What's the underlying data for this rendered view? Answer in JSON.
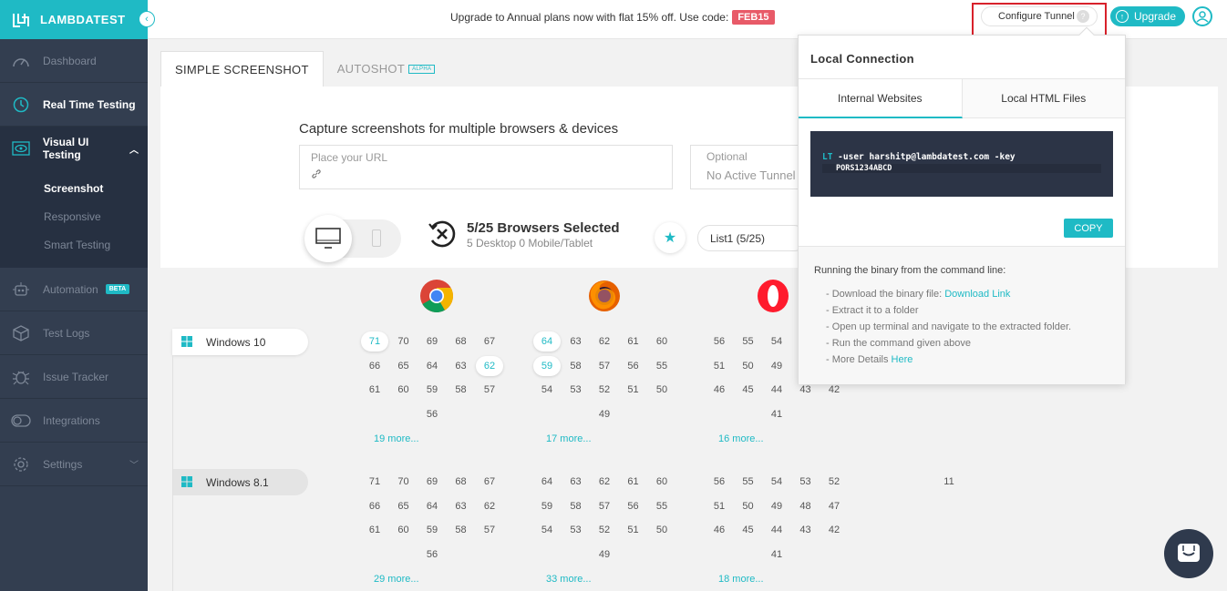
{
  "brand": {
    "name": "LAMBDATEST"
  },
  "sidebar": {
    "items": [
      {
        "label": "Dashboard"
      },
      {
        "label": "Real Time Testing"
      },
      {
        "label": "Visual UI Testing"
      },
      {
        "label": "Automation",
        "badge": "BETA"
      },
      {
        "label": "Test Logs"
      },
      {
        "label": "Issue Tracker"
      },
      {
        "label": "Integrations"
      },
      {
        "label": "Settings"
      }
    ],
    "sub_items": [
      {
        "label": "Screenshot"
      },
      {
        "label": "Responsive"
      },
      {
        "label": "Smart Testing"
      }
    ]
  },
  "topbar": {
    "promo_text": "Upgrade to Annual plans now with flat 15% off. Use code:",
    "promo_code": "FEB15",
    "tunnel_label": "Configure Tunnel",
    "tunnel_help": "?",
    "upgrade_label": "Upgrade"
  },
  "tabs": [
    {
      "label": "SIMPLE SCREENSHOT"
    },
    {
      "label": "AUTOSHOT",
      "badge": "ALPHA"
    }
  ],
  "main": {
    "capture_title": "Capture screenshots for multiple browsers & devices",
    "url_placeholder": "Place your URL",
    "tunnel_optional": "Optional",
    "tunnel_value": "No Active Tunnel",
    "browsers_selected": "5/25 Browsers Selected",
    "browsers_sub": "5 Desktop 0 Mobile/Tablet",
    "list_label": "List1   (5/25)"
  },
  "grid": {
    "os": [
      {
        "name": "Windows 10",
        "chrome": {
          "rows": [
            [
              "71",
              "70",
              "69",
              "68",
              "67"
            ],
            [
              "66",
              "65",
              "64",
              "63",
              "62"
            ],
            [
              "61",
              "60",
              "59",
              "58",
              "57"
            ],
            [
              "",
              "",
              "56",
              "",
              ""
            ]
          ],
          "more": "19 more..."
        },
        "firefox": {
          "rows": [
            [
              "64",
              "63",
              "62",
              "61",
              "60"
            ],
            [
              "59",
              "58",
              "57",
              "56",
              "55"
            ],
            [
              "54",
              "53",
              "52",
              "51",
              "50"
            ],
            [
              "",
              "",
              "49",
              "",
              ""
            ]
          ],
          "more": "17 more..."
        },
        "opera": {
          "rows": [
            [
              "56",
              "55",
              "54",
              "",
              ""
            ],
            [
              "51",
              "50",
              "49",
              "",
              ""
            ],
            [
              "46",
              "45",
              "44",
              "43",
              "42"
            ],
            [
              "",
              "",
              "41",
              "",
              ""
            ]
          ],
          "more": "16 more..."
        }
      },
      {
        "name": "Windows 8.1",
        "chrome": {
          "rows": [
            [
              "71",
              "70",
              "69",
              "68",
              "67"
            ],
            [
              "66",
              "65",
              "64",
              "63",
              "62"
            ],
            [
              "61",
              "60",
              "59",
              "58",
              "57"
            ],
            [
              "",
              "",
              "56",
              "",
              ""
            ]
          ],
          "more": "29 more..."
        },
        "firefox": {
          "rows": [
            [
              "64",
              "63",
              "62",
              "61",
              "60"
            ],
            [
              "59",
              "58",
              "57",
              "56",
              "55"
            ],
            [
              "54",
              "53",
              "52",
              "51",
              "50"
            ],
            [
              "",
              "",
              "49",
              "",
              ""
            ]
          ],
          "more": "33 more..."
        },
        "opera": {
          "rows": [
            [
              "56",
              "55",
              "54",
              "53",
              "52"
            ],
            [
              "51",
              "50",
              "49",
              "48",
              "47"
            ],
            [
              "46",
              "45",
              "44",
              "43",
              "42"
            ],
            [
              "",
              "",
              "41",
              "",
              ""
            ]
          ],
          "more": "18 more..."
        },
        "extra": "11"
      }
    ]
  },
  "popup": {
    "title": "Local Connection",
    "tab_internal": "Internal Websites",
    "tab_local": "Local HTML Files",
    "code_prefix": "LT",
    "code_line1": " -user harshitp@lambdatest.com -key",
    "code_line2": "PORS1234ABCD",
    "copy_label": "COPY",
    "footer_title": "Running the binary from the command line:",
    "step1_text": "- Download the binary file: ",
    "step1_link": "Download Link",
    "step2": "- Extract it to a folder",
    "step3": "- Open up terminal and navigate to the extracted folder.",
    "step4": "- Run the command given above",
    "step5_text": "- More Details ",
    "step5_link": "Here"
  },
  "colors": {
    "accent": "#1fbac5",
    "sidebar": "#333e50",
    "promo": "#e85a68",
    "highlight": "#d8212b"
  }
}
